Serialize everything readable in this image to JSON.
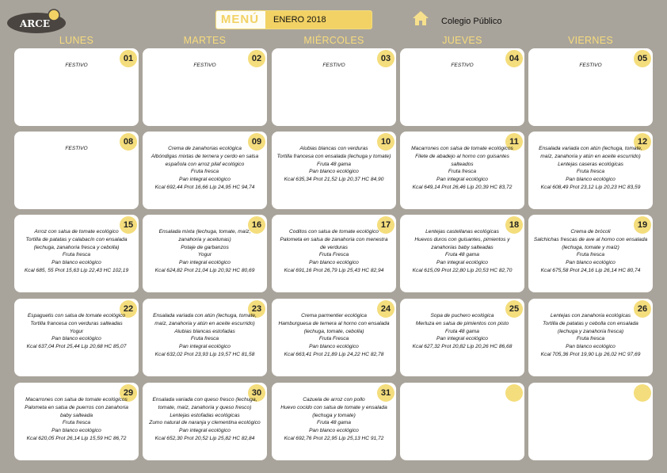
{
  "header": {
    "logo_text": "ARCE",
    "menu_label": "MENÚ",
    "month": "ENERO 2018",
    "school": "Colegio Público"
  },
  "days": [
    "LUNES",
    "MARTES",
    "MIÉRCOLES",
    "JUEVES",
    "VIERNES"
  ],
  "colors": {
    "background": "#a9a49b",
    "accent": "#f2d264",
    "card": "#ffffff"
  },
  "weeks": [
    [
      {
        "n": "01",
        "lines": [
          "FESTIVO"
        ]
      },
      {
        "n": "02",
        "lines": [
          "FESTIVO"
        ]
      },
      {
        "n": "03",
        "lines": [
          "FESTIVO"
        ]
      },
      {
        "n": "04",
        "lines": [
          "FESTIVO"
        ]
      },
      {
        "n": "05",
        "lines": [
          "FESTIVO"
        ]
      }
    ],
    [
      {
        "n": "08",
        "lines": [
          "FESTIVO"
        ]
      },
      {
        "n": "09",
        "lines": [
          "Crema de zanahorias ecológica",
          "Albóndigas mixtas de ternera y cerdo en salsa española con arroz pilaf ecológico",
          "Fruta fresca",
          "Pan integral ecológico",
          "Kcal 692,44 Prot 16,66 Lip 24,95 HC 94,74"
        ]
      },
      {
        "n": "10",
        "lines": [
          "Alubias blancas con verduras",
          "Tortilla francesa con ensalada (lechuga y tomate)",
          "Fruta 48 gama",
          "Pan blanco ecológico",
          "Kcal 635,34 Prot 21,52 Lip 20,37 HC 84,90"
        ]
      },
      {
        "n": "11",
        "lines": [
          "Macarrones con salsa de tomate ecológicos",
          "Filete de abadejo al horno con guisantes salteados",
          "Fruta fresca",
          "Pan integral ecológico",
          "Kcal 649,14 Prot 26,46 Lip 20,39 HC 83,72"
        ]
      },
      {
        "n": "12",
        "lines": [
          "Ensalada variada con atún (lechuga, tomate, maíz, zanahoria y atún en aceite escurrido)",
          "Lentejas caseras ecológicas",
          "Fruta fresca",
          "Pan blanco ecológico",
          "Kcal 608,49 Prot 23,12 Lip 20,23 HC 83,59"
        ]
      }
    ],
    [
      {
        "n": "15",
        "lines": [
          "Arroz con salsa de tomate ecológico",
          "Tortilla de patatas y calabacín con ensalada (lechuga, zanahoria fresca y cebolla)",
          "Fruta fresca",
          "Pan blanco ecológico",
          "Kcal 685, 55 Prot 15,63 Lip 22,43 HC 102,19"
        ]
      },
      {
        "n": "16",
        "lines": [
          "Ensalada mixta (lechuga, tomate, maíz, zanahoria y aceitunas)",
          "Potaje de garbanzos",
          "Yogur",
          "Pan integral ecológico",
          "Kcal 624,82 Prot 21,04 Lip 20,92 HC 80,69"
        ]
      },
      {
        "n": "17",
        "lines": [
          "Coditos con salsa de tomate ecológico",
          "Palometa en salsa de zanahoria con menestra de verduras",
          "Fruta Fresca",
          "Pan blanco ecológico",
          "Kcal 691,16 Prot 26,79 Lip 25,43 HC 82,94"
        ]
      },
      {
        "n": "18",
        "lines": [
          "Lentejas castellanas ecológicas",
          "Huevos duros con guisantes, pimientos y zanahorias baby salteadas",
          "Fruta 48 gama",
          "Pan integral ecológico",
          "Kcal 615,09 Prot 22,80 Lip 20,53 HC 82,70"
        ]
      },
      {
        "n": "19",
        "lines": [
          "Crema de brócoli",
          "Salchichas frescas de ave al horno con ensalada (lechuga, tomate y maíz)",
          "Fruta fresca",
          "Pan blanco ecológico",
          "Kcal 675,58 Prot 24,16 Lip 26,14 HC 80,74"
        ]
      }
    ],
    [
      {
        "n": "22",
        "lines": [
          "Espaguetis con salsa de tomate ecológico",
          "Tortilla francesa con verduras salteadas",
          "Yogur",
          "Pan blanco ecológico",
          "Kcal 637,04 Prot 25,44 Lip 20,68 HC 85,07"
        ]
      },
      {
        "n": "23",
        "lines": [
          "Ensalada variada con atún (lechuga, tomate, maíz, zanahoria y atún en aceite escurrido)",
          "Alubias blancas estofadas",
          "Fruta fresca",
          "Pan integral ecológico",
          "Kcal 632,02 Prot 23,93 Lip 19,57 HC 81,58"
        ]
      },
      {
        "n": "24",
        "lines": [
          "Crema parmentier ecológica",
          "Hamburguesa de ternera al horno con ensalada (lechuga, tomate, cebolla)",
          "Fruta Fresca",
          "Pan blanco ecológico",
          "Kcal 663,41 Prot 21,89 Lip 24,22 HC 82,78"
        ]
      },
      {
        "n": "25",
        "lines": [
          "Sopa de puchero ecológica",
          "Merluza en salsa de pimientos con pisto",
          "Fruta 48 gama",
          "Pan integral ecológico",
          "Kcal 627,32 Prot 20,82 Lip 20,26 HC 86,68"
        ]
      },
      {
        "n": "26",
        "lines": [
          "Lentejas con zanahoria ecológicas",
          "Tortilla de patatas y cebolla con ensalada (lechuga y zanahoria fresca)",
          "Fruta fresca",
          "Pan blanco ecológico",
          "Kcal 705,36 Prot 19,90 Lip 26,02 HC 97,69"
        ]
      }
    ],
    [
      {
        "n": "29",
        "lines": [
          "Macarrones con salsa de tomate ecológicos",
          "Palometa en salsa de puerros con zanahoria baby salteada",
          "Fruta fresca",
          "Pan blanco ecológico",
          "Kcal 620,05 Prot 26,14 Lip 15,59 HC 86,72"
        ]
      },
      {
        "n": "30",
        "lines": [
          "Ensalada variada con queso fresco (lechuga, tomate, maíz, zanahoria y queso fresco)",
          "Lentejas estofadas ecológicas",
          "Zumo natural de naranja y clementina ecológico",
          "Pan integral ecológico",
          "Kcal 652,30 Prot 20,52 Lip 25,82 HC 82,84"
        ]
      },
      {
        "n": "31",
        "lines": [
          "Cazuela de arroz con pollo",
          "Huevo cocido con salsa de tomate y ensalada (lechuga y tomate)",
          "Fruta 48 gama",
          "Pan blanco ecológico",
          "Kcal 692,76 Prot 22,95 Lip 25,13 HC 91,72"
        ]
      },
      {
        "n": "",
        "lines": []
      },
      {
        "n": "",
        "lines": []
      }
    ]
  ]
}
